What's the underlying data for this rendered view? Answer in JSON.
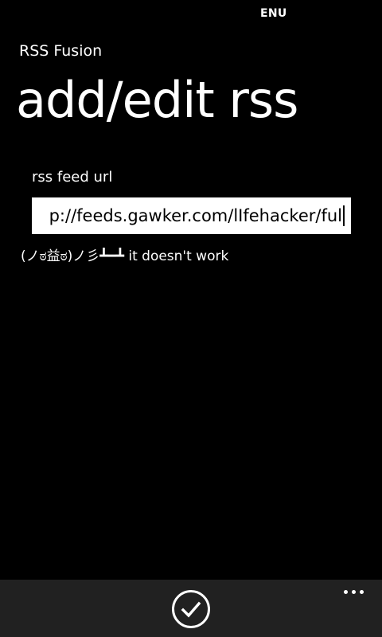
{
  "status_bar": {
    "language": "ENU"
  },
  "app": {
    "name": "RSS Fusion"
  },
  "page": {
    "title": "add/edit rss"
  },
  "form": {
    "url_label": "rss feed url",
    "url_value": "http://feeds.gawker.com/lIfehacker/ful",
    "url_visible": "p://feeds.gawker.com/lIfehacker/ful",
    "error_message": "(ノಠ益ಠ)ノ彡┻━┻ it doesn't work"
  },
  "app_bar": {
    "confirm_icon": "check-icon",
    "more_icon": "ellipsis-icon",
    "background": "#212121"
  }
}
